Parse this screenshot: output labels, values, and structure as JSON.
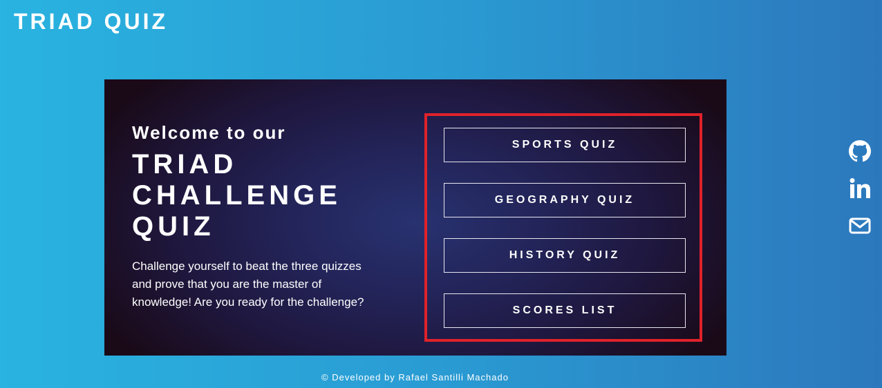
{
  "header": {
    "title": "TRIAD QUIZ"
  },
  "hero": {
    "welcome": "Welcome to our",
    "title": "TRIAD CHALLENGE QUIZ",
    "description": "Challenge yourself to beat the three quizzes and prove that you are the master of knowledge! Are you ready for the challenge?"
  },
  "menu": {
    "buttons": [
      {
        "label": "SPORTS QUIZ"
      },
      {
        "label": "GEOGRAPHY QUIZ"
      },
      {
        "label": "HISTORY QUIZ"
      },
      {
        "label": "SCORES LIST"
      }
    ],
    "highlight_color": "#e0222a"
  },
  "social": {
    "icons": [
      "github-icon",
      "linkedin-icon",
      "email-icon"
    ]
  },
  "footer": {
    "text": "© Developed by Rafael Santilli Machado"
  },
  "colors": {
    "background_start": "#29b3e0",
    "background_end": "#2c78bd",
    "card_dark": "#1a0a18",
    "card_center": "#283270"
  }
}
